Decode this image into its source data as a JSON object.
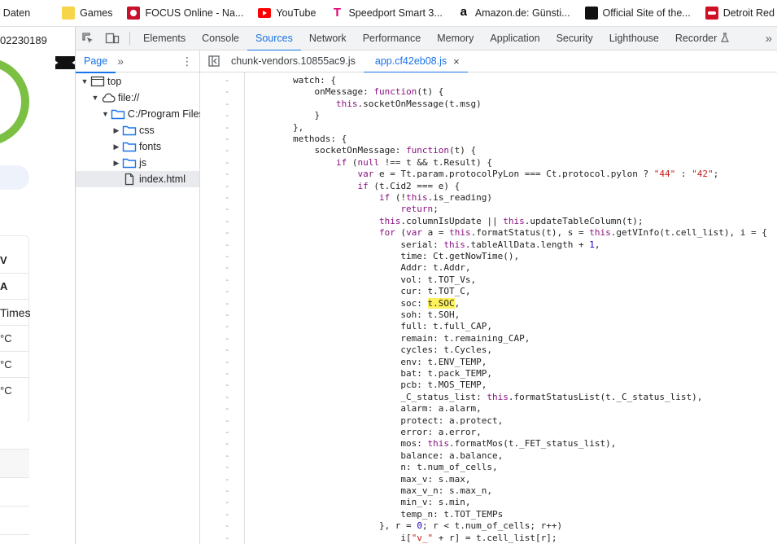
{
  "bookmarks": [
    {
      "label": "V Daten",
      "icon": "none"
    },
    {
      "label": "Games",
      "icon": "folder-icon"
    },
    {
      "label": "FOCUS Online - Na...",
      "icon": "focus-icon"
    },
    {
      "label": "YouTube",
      "icon": "youtube-icon"
    },
    {
      "label": "Speedport Smart 3...",
      "icon": "telekom-icon"
    },
    {
      "label": "Amazon.de: Günsti...",
      "icon": "amazon-icon"
    },
    {
      "label": "Official Site of the...",
      "icon": "nhl-icon"
    },
    {
      "label": "Detroit Red Wings |...",
      "icon": "red-wings-icon"
    }
  ],
  "page": {
    "number": "02230189",
    "labels": [
      "V",
      "A",
      "Times",
      "°C",
      "°C",
      "°C"
    ]
  },
  "devtools": {
    "tabs": [
      "Elements",
      "Console",
      "Sources",
      "Network",
      "Performance",
      "Memory",
      "Application",
      "Security",
      "Lighthouse",
      "Recorder"
    ],
    "active_tab": "Sources",
    "more": "»"
  },
  "navigator": {
    "tab": "Page",
    "tree": [
      {
        "label": "top",
        "depth": 0,
        "expanded": true,
        "kind": "frame"
      },
      {
        "label": "file://",
        "depth": 1,
        "expanded": true,
        "kind": "cloud"
      },
      {
        "label": "C:/Program Files",
        "depth": 2,
        "expanded": true,
        "kind": "folder"
      },
      {
        "label": "css",
        "depth": 3,
        "expanded": false,
        "kind": "folder"
      },
      {
        "label": "fonts",
        "depth": 3,
        "expanded": false,
        "kind": "folder"
      },
      {
        "label": "js",
        "depth": 3,
        "expanded": false,
        "kind": "folder"
      },
      {
        "label": "index.html",
        "depth": 3,
        "expanded": null,
        "kind": "file"
      }
    ]
  },
  "editor": {
    "tabs": [
      {
        "label": "chunk-vendors.10855ac9.js",
        "active": false
      },
      {
        "label": "app.cf42eb08.js",
        "active": true
      }
    ],
    "close": "×",
    "gutter_mark": "-",
    "highlight": "t.SOC",
    "lines": [
      "        watch: {",
      "            onMessage: function(t) {",
      "                this.socketOnMessage(t.msg)",
      "            }",
      "        },",
      "        methods: {",
      "            socketOnMessage: function(t) {",
      "                if (null !== t && t.Result) {",
      "                    var e = Tt.param.protocolPyLon === Ct.protocol.pylon ? \"44\" : \"42\";",
      "                    if (t.Cid2 === e) {",
      "                        if (!this.is_reading)",
      "                            return;",
      "                        this.columnIsUpdate || this.updateTableColumn(t);",
      "                        for (var a = this.formatStatus(t), s = this.getVInfo(t.cell_list), i = {",
      "                            serial: this.tableAllData.length + 1,",
      "                            time: Ct.getNowTime(),",
      "                            Addr: t.Addr,",
      "                            vol: t.TOT_Vs,",
      "                            cur: t.TOT_C,",
      "                            soc: t.SOC,",
      "                            soh: t.SOH,",
      "                            full: t.full_CAP,",
      "                            remain: t.remaining_CAP,",
      "                            cycles: t.Cycles,",
      "                            env: t.ENV_TEMP,",
      "                            bat: t.pack_TEMP,",
      "                            pcb: t.MOS_TEMP,",
      "                            _C_status_list: this.formatStatusList(t._C_status_list),",
      "                            alarm: a.alarm,",
      "                            protect: a.protect,",
      "                            error: a.error,",
      "                            mos: this.formatMos(t._FET_status_list),",
      "                            balance: a.balance,",
      "                            n: t.num_of_cells,",
      "                            max_v: s.max,",
      "                            max_v_n: s.max_n,",
      "                            min_v: s.min,",
      "                            temp_n: t.TOT_TEMPs",
      "                        }, r = 0; r < t.num_of_cells; r++)",
      "                            i[\"v_\" + r] = t.cell_list[r];"
    ]
  },
  "colors": {
    "accent": "#1a73e8",
    "keyword": "#881280",
    "string": "#c41a16",
    "number": "#1c00cf",
    "highlight": "#fdf25d",
    "ring": "#7bc043"
  }
}
